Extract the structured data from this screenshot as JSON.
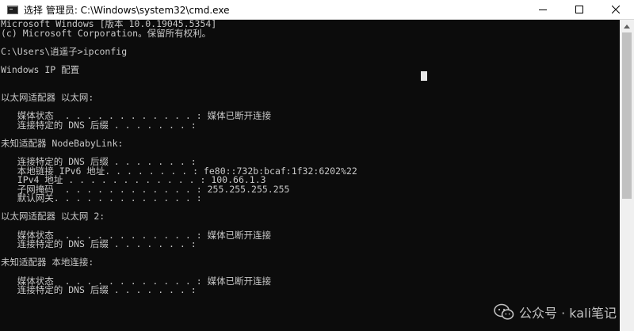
{
  "window": {
    "title": "选择 管理员: C:\\Windows\\system32\\cmd.exe",
    "controls": {
      "minimize": "minimize-icon",
      "maximize": "maximize-icon",
      "close": "close-icon"
    }
  },
  "console": {
    "lines": [
      "Microsoft Windows [版本 10.0.19045.5354]",
      "(c) Microsoft Corporation。保留所有权利。",
      "",
      "C:\\Users\\逍遥子>ipconfig",
      "",
      "Windows IP 配置",
      "",
      "",
      "以太网适配器 以太网:",
      "",
      "   媒体状态  . . . . . . . . . . . . : 媒体已断开连接",
      "   连接特定的 DNS 后缀 . . . . . . . :",
      "",
      "未知适配器 NodeBabyLink:",
      "",
      "   连接特定的 DNS 后缀 . . . . . . . :",
      "   本地链接 IPv6 地址. . . . . . . . : fe80::732b:bcaf:1f32:6202%22",
      "   IPv4 地址 . . . . . . . . . . . . : 100.66.1.3",
      "   子网掩码  . . . . . . . . . . . . : 255.255.255.255",
      "   默认网关. . . . . . . . . . . . . :",
      "",
      "以太网适配器 以太网 2:",
      "",
      "   媒体状态  . . . . . . . . . . . . : 媒体已断开连接",
      "   连接特定的 DNS 后缀 . . . . . . . :",
      "",
      "未知适配器 本地连接:",
      "",
      "   媒体状态  . . . . . . . . . . . . : 媒体已断开连接",
      "   连接特定的 DNS 后缀 . . . . . . . :"
    ]
  },
  "watermark": {
    "text": "公众号 · kali笔记",
    "icon": "wechat-logo-icon"
  },
  "colors": {
    "background": "#0c0c0c",
    "text": "#c8c8c8",
    "titlebar": "#ffffff"
  }
}
